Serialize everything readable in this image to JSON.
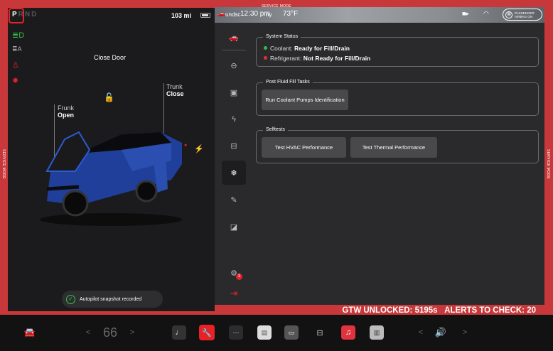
{
  "service_mode_top": "SERVICE MODE",
  "service_mode_side": "SERVICE MODE",
  "drive": {
    "gears": [
      "P",
      "R",
      "N",
      "D"
    ],
    "selected": "P"
  },
  "range": "103 mi",
  "car_labels": {
    "close_door": "Close Door",
    "trunk_title": "Trunk",
    "trunk_action": "Close",
    "frunk_title": "Frunk",
    "frunk_action": "Open"
  },
  "toast": "Autopilot snapshot recorded",
  "topbar": {
    "location": "undsc",
    "time": "12:30 pm",
    "temp": "73°F",
    "suffix": "ny",
    "passenger_airbag": "PASSENGER AIRBAG ON",
    "passenger_airbag_line1": "PASSENGER",
    "passenger_airbag_line2": "AIRBAG ON"
  },
  "system_status": {
    "legend": "System Status",
    "rows": [
      {
        "label": "Coolant:",
        "value": "Ready for Fill/Drain",
        "color": "#2fbf45"
      },
      {
        "label": "Refrigerant:",
        "value": "Not Ready for Fill/Drain",
        "color": "#e0322f"
      }
    ]
  },
  "post_fluid": {
    "legend": "Post Fluid Fill Tasks",
    "button": "Run Coolant Pumps Identification"
  },
  "selftests": {
    "legend": "Selftests",
    "buttons": [
      "Test HVAC Performance",
      "Test Thermal Performance"
    ]
  },
  "status_bar": {
    "gtw": "GTW UNLOCKED: 5195s",
    "alerts": "ALERTS TO CHECK: 20"
  },
  "nav_badge": "3",
  "dock": {
    "temp": "66",
    "temp_left": "<",
    "temp_right": ">",
    "vol_left": "<",
    "vol_right": ">"
  },
  "colors": {
    "frame": "#c8383a",
    "accent_red": "#e82127",
    "car_blue": "#1f3f9a",
    "ready_green": "#2fbf45"
  }
}
